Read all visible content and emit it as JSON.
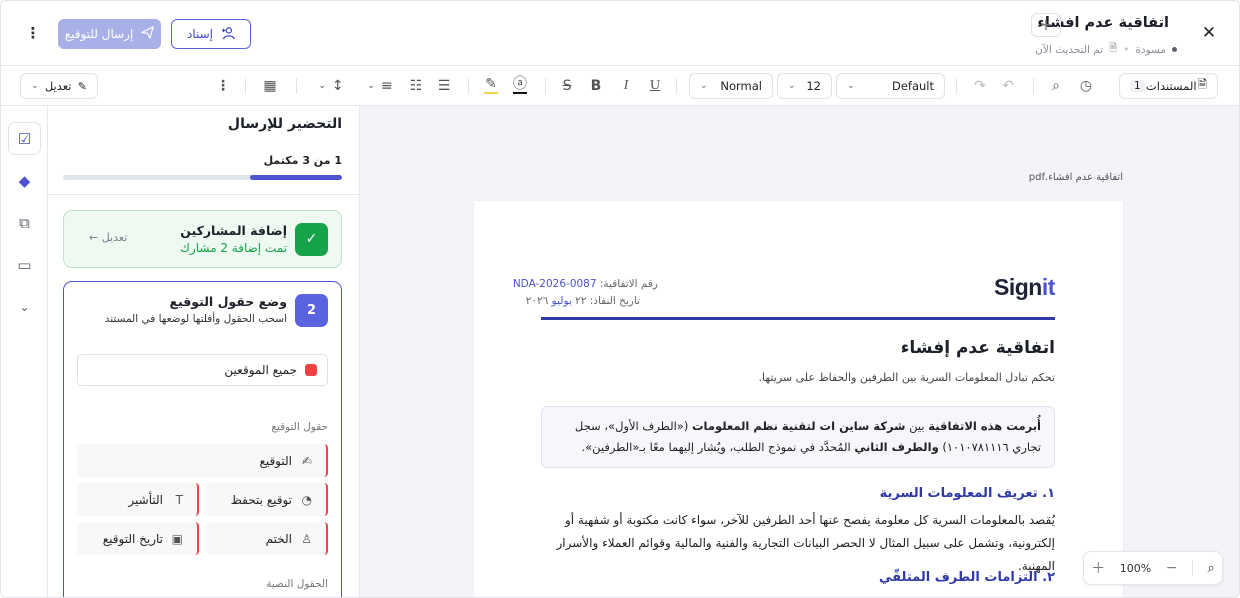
{
  "header": {
    "title": "اتفاقية عدم افشاء",
    "add_glyph": "+",
    "status_draft": "مسودة",
    "updated": "تم التحديث الآن",
    "send_label": "إرسال للتوقيع",
    "assign_label": "إسناد"
  },
  "toolbar": {
    "documents_label": "المستندات",
    "documents_count": "1",
    "font_family": "Default",
    "font_size": "12",
    "text_style": "Normal",
    "edit_label": "تعديل"
  },
  "panel": {
    "title": "التحضير للإرسال",
    "progress_label": "1 من 3 مكتمل",
    "progress": 0.33,
    "step1": {
      "title": "إضافة المشاركين",
      "subtitle": "تمت إضافة 2 مشارك",
      "edit": "تعديل"
    },
    "step2": {
      "number": "2",
      "title": "وضع حقول التوقيع",
      "subtitle": "اسحب الحقول وأفلتها لوضعها في المستند",
      "signer": "جميع الموقعين",
      "section_signature": "حقول التوقيع",
      "section_text": "الحقول النصية",
      "fields": {
        "signature": "التوقيع",
        "initials": "التأشير",
        "reserved": "توقيع بتحفظ",
        "stamp": "الختم",
        "sign_date": "تاريخ التوقيع"
      }
    }
  },
  "document": {
    "file_name": "اتفاقية عدم افشاء.pdf",
    "brand_main": "Sign",
    "brand_accent": "it",
    "agreement_no_label": "رقم الاتفاقية:",
    "agreement_no": "NDA-2026-0087",
    "effective_label": "تاريخ النفاذ: ٢٢",
    "effective_month": "يوليو",
    "effective_year": "٢٠٢٦",
    "title": "اتفاقية عدم إفشاء",
    "subtitle": "تحكم تبادل المعلومات السرية بين الطرفين والحفاظ على سريتها.",
    "intro_bold1": "أُبرمت هذه الاتفاقية",
    "intro_t1": " بين ",
    "intro_bold2": "شركة ساين ات لتقنية نظم المعلومات",
    "intro_t2": " («الطرف الأول»، سجل تجاري ١٠١٠٧٨١١١٦) ",
    "intro_bold3": "والطرف الثاني",
    "intro_t3": " المُحدَّد في نموذج الطلب، ويُشار إليهما معًا بـ«الطرفين».",
    "s1_heading": "١. تعريف المعلومات السرية",
    "s1_body": "يُقصد بالمعلومات السرية كل معلومة يفصح عنها أحد الطرفين للآخر، سواء كانت مكتوبة أو شفهية أو إلكترونية، وتشمل على سبيل المثال لا الحصر البيانات التجارية والفنية والمالية وقوائم العملاء والأسرار المهنية.",
    "s2_heading": "٢. التزامات الطرف المتلقّي"
  },
  "zoom": {
    "level": "100%"
  }
}
